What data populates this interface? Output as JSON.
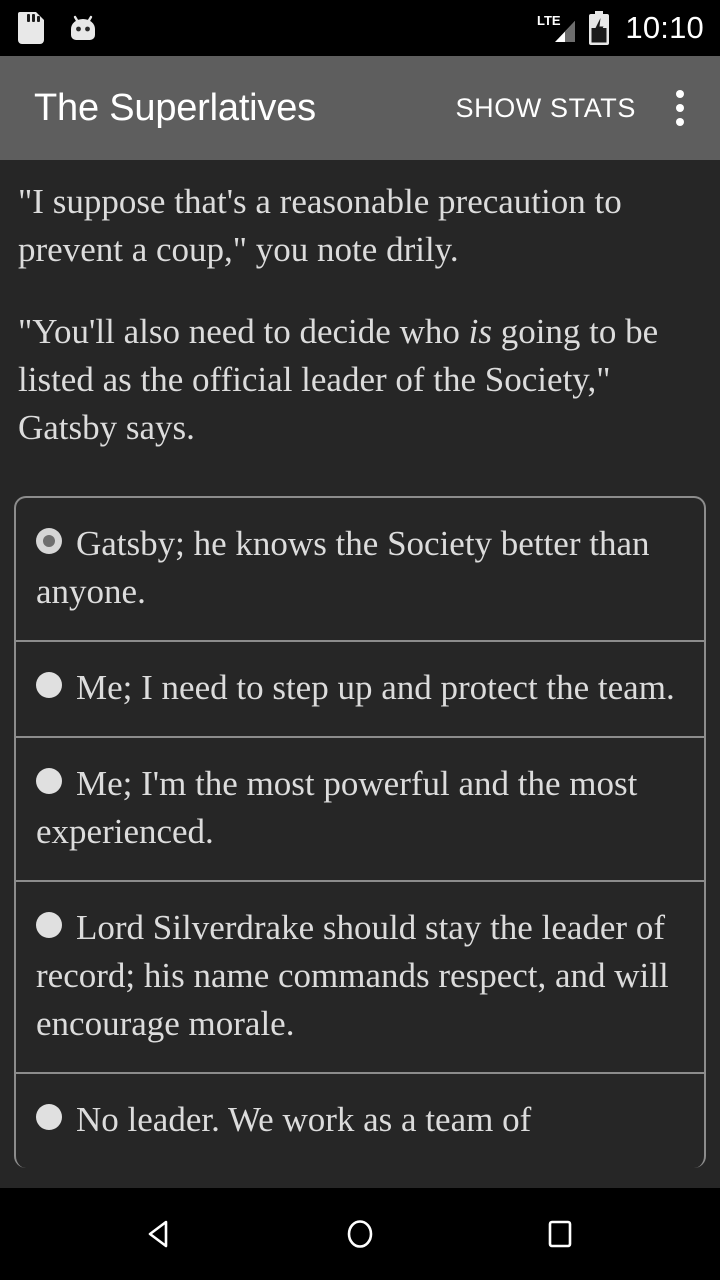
{
  "status_bar": {
    "icons": [
      "sd-card-icon",
      "android-droid-icon"
    ],
    "network_label": "LTE",
    "signal_icon": "signal-bars-icon",
    "battery_icon": "battery-charging-icon",
    "time": "10:10"
  },
  "app_bar": {
    "title": "The Superlatives",
    "action_label": "SHOW STATS",
    "overflow_icon": "overflow-menu-icon"
  },
  "story": {
    "paragraphs": [
      {
        "parts": [
          {
            "text": "\"I suppose that's a reasonable precaution to prevent a coup,\" you note drily.",
            "italic": false
          }
        ]
      },
      {
        "parts": [
          {
            "text": "\"You'll also need to decide who ",
            "italic": false
          },
          {
            "text": "is",
            "italic": true
          },
          {
            "text": " going to be listed as the official leader of the Society,\" Gatsby says.",
            "italic": false
          }
        ]
      }
    ]
  },
  "choices": {
    "selected_index": 0,
    "options": [
      {
        "label": "Gatsby; he knows the Society better than anyone.",
        "selected": true
      },
      {
        "label": "Me; I need to step up and protect the team.",
        "selected": false
      },
      {
        "label": "Me; I'm the most powerful and the most experienced.",
        "selected": false
      },
      {
        "label": "Lord Silverdrake should stay the leader of record; his name commands respect, and will encourage morale.",
        "selected": false
      },
      {
        "label": "No leader. We work as a team of",
        "selected": false
      }
    ]
  },
  "nav_bar": {
    "back_icon": "back-triangle-icon",
    "home_icon": "home-circle-icon",
    "recents_icon": "recents-square-icon"
  },
  "colors": {
    "background": "#262626",
    "app_bar": "#5e5e5e",
    "system_bar": "#000000",
    "text": "#dcdcdc",
    "border": "#8c8c8c",
    "accent": "#ffffff"
  }
}
